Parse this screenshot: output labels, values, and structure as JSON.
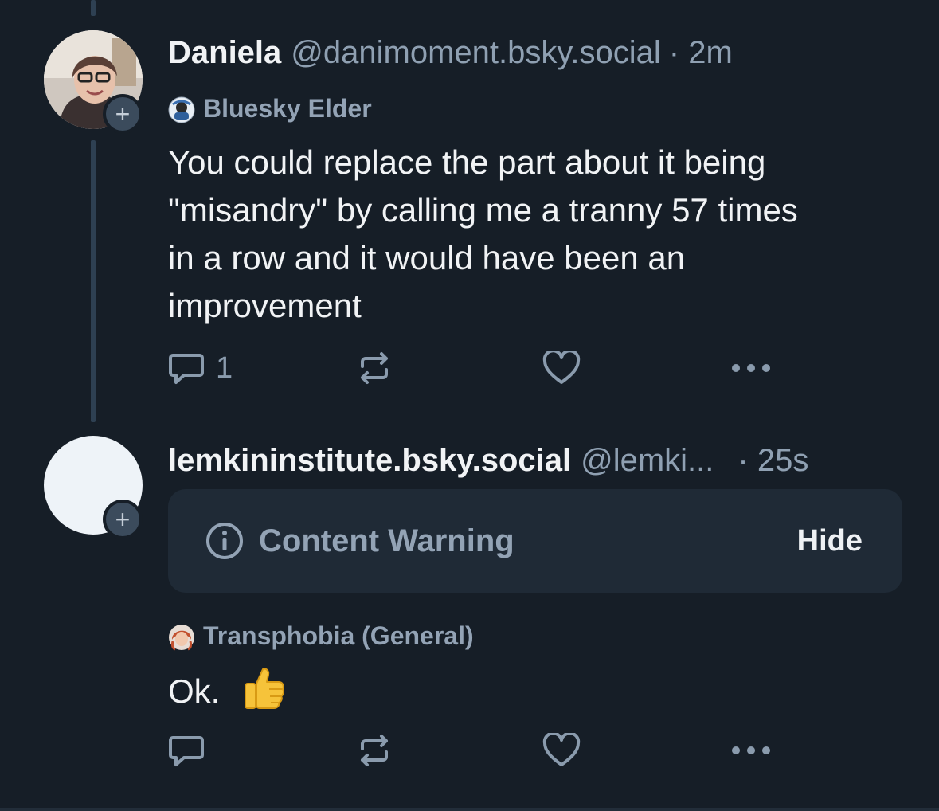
{
  "colors": {
    "background": "#161e27",
    "text_primary": "#f1f3f5",
    "text_secondary": "#8fa0b2",
    "thread_line": "#2e4052",
    "content_warning_bg": "#1f2a36"
  },
  "posts": [
    {
      "display_name": "Daniela",
      "handle": "@danimoment.bsky.social",
      "time": "· 2m",
      "label": "Bluesky Elder",
      "text_lines": [
        "You could replace the part about it being",
        "\"misandry\" by calling me a tranny 57 times",
        "in a row and it would have been an",
        "improvement"
      ],
      "reply_count": "1",
      "follow_icon": "+"
    },
    {
      "display_name": "lemkininstitute.bsky.social",
      "handle": "@lemki...",
      "time": "· 25s",
      "content_warning": {
        "label": "Content Warning",
        "action": "Hide",
        "icon": "info-icon"
      },
      "label": "Transphobia (General)",
      "text": "Ok.",
      "reply_count": "",
      "follow_icon": "+"
    }
  ]
}
